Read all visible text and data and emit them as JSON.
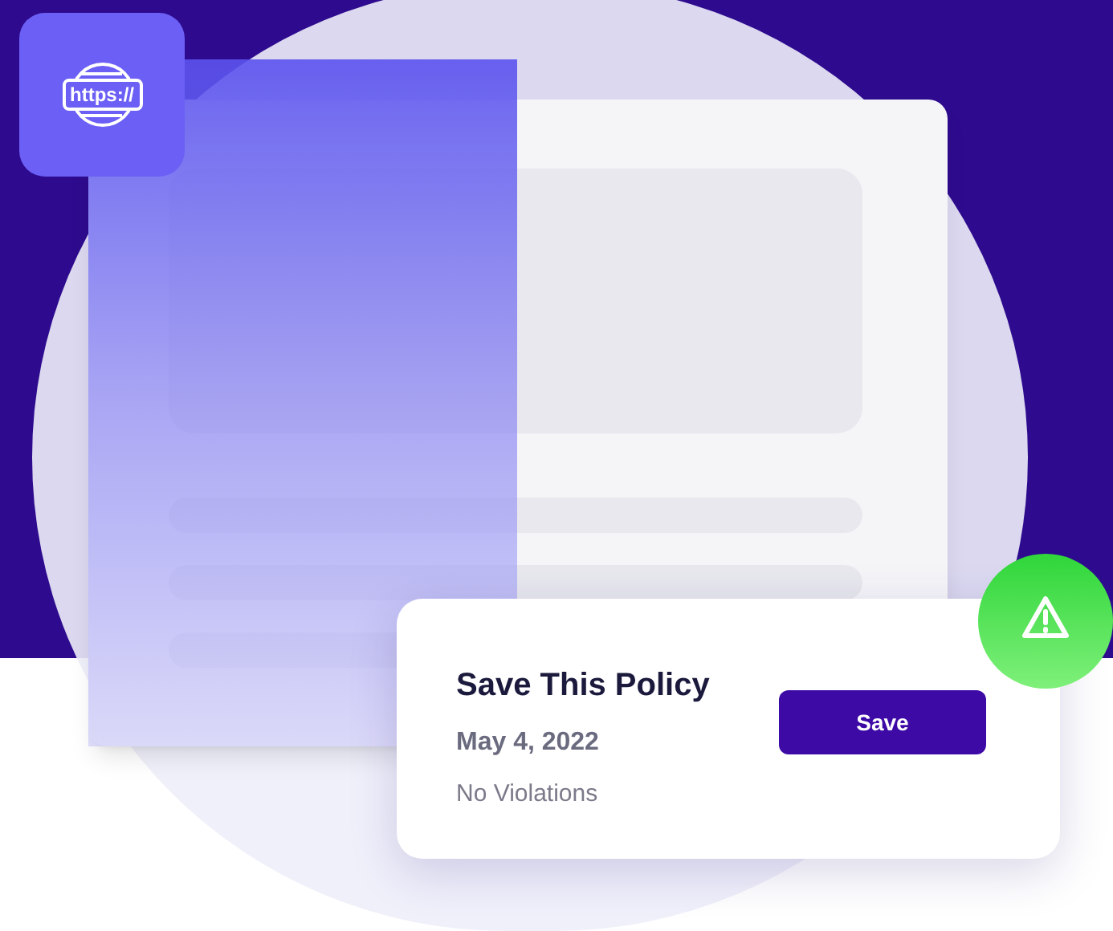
{
  "url_badge": {
    "text": "https://"
  },
  "policy_card": {
    "title": "Save This Policy",
    "date": "May 4, 2022",
    "status": "No Violations",
    "button": "Save"
  }
}
